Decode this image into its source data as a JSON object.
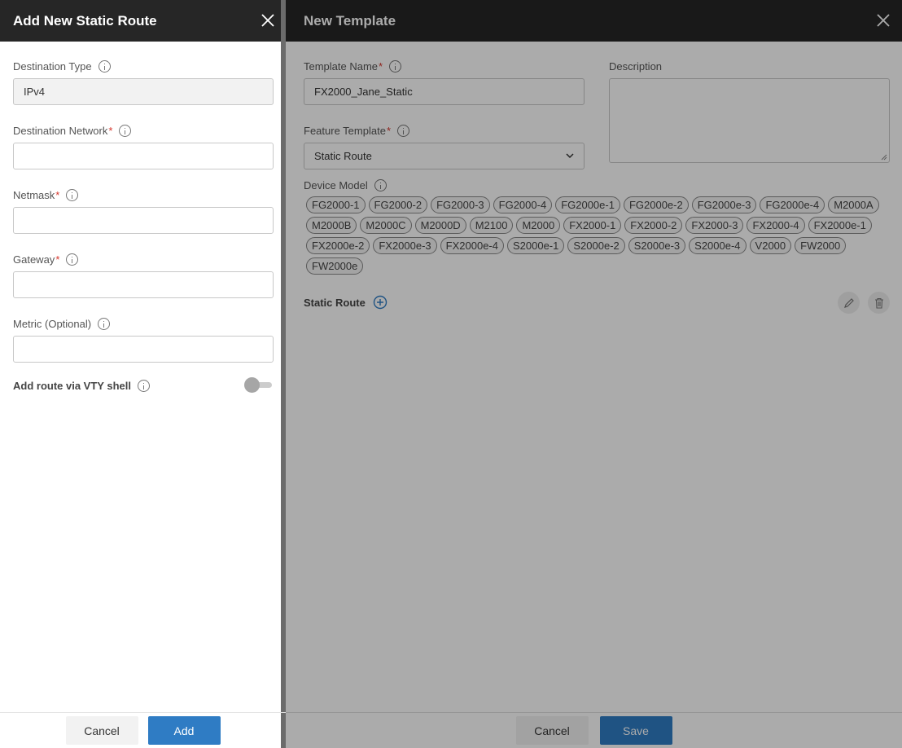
{
  "template_panel": {
    "title": "New Template",
    "template_name": {
      "label": "Template Name",
      "value": "FX2000_Jane_Static"
    },
    "feature_template": {
      "label": "Feature Template",
      "value": "Static Route"
    },
    "description": {
      "label": "Description",
      "value": ""
    },
    "device_model": {
      "label": "Device Model",
      "tags": [
        "FG2000-1",
        "FG2000-2",
        "FG2000-3",
        "FG2000-4",
        "FG2000e-1",
        "FG2000e-2",
        "FG2000e-3",
        "FG2000e-4",
        "M2000A",
        "M2000B",
        "M2000C",
        "M2000D",
        "M2100",
        "M2000",
        "FX2000-1",
        "FX2000-2",
        "FX2000-3",
        "FX2000-4",
        "FX2000e-1",
        "FX2000e-2",
        "FX2000e-3",
        "FX2000e-4",
        "S2000e-1",
        "S2000e-2",
        "S2000e-3",
        "S2000e-4",
        "V2000",
        "FW2000",
        "FW2000e"
      ]
    },
    "static_route_label": "Static Route",
    "cancel_label": "Cancel",
    "save_label": "Save"
  },
  "drawer": {
    "title": "Add New Static Route",
    "destination_type": {
      "label": "Destination Type",
      "value": "IPv4"
    },
    "destination_network": {
      "label": "Destination Network",
      "value": ""
    },
    "netmask": {
      "label": "Netmask",
      "value": ""
    },
    "gateway": {
      "label": "Gateway",
      "value": ""
    },
    "metric": {
      "label": "Metric (Optional)",
      "value": ""
    },
    "vty_shell": {
      "label": "Add route via VTY shell",
      "enabled": false
    },
    "cancel_label": "Cancel",
    "add_label": "Add"
  }
}
